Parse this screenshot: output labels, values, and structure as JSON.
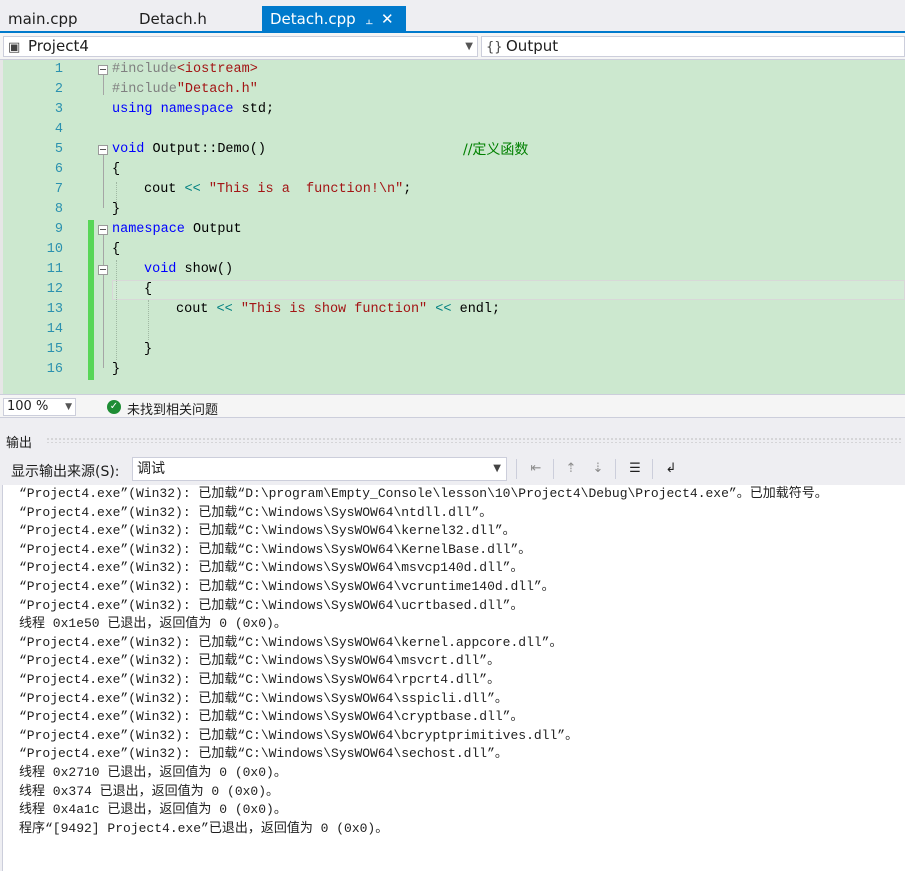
{
  "tabs": [
    {
      "label": "main.cpp",
      "active": false
    },
    {
      "label": "Detach.h",
      "active": false
    },
    {
      "label": "Detach.cpp",
      "active": true
    }
  ],
  "tab_icons": {
    "pin": "pin-icon",
    "close": "close-icon"
  },
  "navbar": {
    "project": "Project4",
    "scope": "Output"
  },
  "editor": {
    "line_numbers": [
      "1",
      "2",
      "3",
      "4",
      "5",
      "6",
      "7",
      "8",
      "9",
      "10",
      "11",
      "12",
      "13",
      "14",
      "15",
      "16"
    ]
  },
  "status": {
    "zoom": "100 %",
    "issues": "未找到相关问题"
  },
  "output": {
    "title": "输出",
    "source_label": "显示输出来源(S):",
    "source_value": "调试",
    "lines": [
      "“Project4.exe”(Win32): 已加载“D:\\program\\Empty_Console\\lesson\\10\\Project4\\Debug\\Project4.exe”。已加载符号。",
      "“Project4.exe”(Win32): 已加载“C:\\Windows\\SysWOW64\\ntdll.dll”。",
      "“Project4.exe”(Win32): 已加载“C:\\Windows\\SysWOW64\\kernel32.dll”。",
      "“Project4.exe”(Win32): 已加载“C:\\Windows\\SysWOW64\\KernelBase.dll”。",
      "“Project4.exe”(Win32): 已加载“C:\\Windows\\SysWOW64\\msvcp140d.dll”。",
      "“Project4.exe”(Win32): 已加载“C:\\Windows\\SysWOW64\\vcruntime140d.dll”。",
      "“Project4.exe”(Win32): 已加载“C:\\Windows\\SysWOW64\\ucrtbased.dll”。",
      "线程 0x1e50 已退出，返回值为 0 (0x0)。",
      "“Project4.exe”(Win32): 已加载“C:\\Windows\\SysWOW64\\kernel.appcore.dll”。",
      "“Project4.exe”(Win32): 已加载“C:\\Windows\\SysWOW64\\msvcrt.dll”。",
      "“Project4.exe”(Win32): 已加载“C:\\Windows\\SysWOW64\\rpcrt4.dll”。",
      "“Project4.exe”(Win32): 已加载“C:\\Windows\\SysWOW64\\sspicli.dll”。",
      "“Project4.exe”(Win32): 已加载“C:\\Windows\\SysWOW64\\cryptbase.dll”。",
      "“Project4.exe”(Win32): 已加载“C:\\Windows\\SysWOW64\\bcryptprimitives.dll”。",
      "“Project4.exe”(Win32): 已加载“C:\\Windows\\SysWOW64\\sechost.dll”。",
      "线程 0x2710 已退出，返回值为 0 (0x0)。",
      "线程 0x374 已退出，返回值为 0 (0x0)。",
      "线程 0x4a1c 已退出，返回值为 0 (0x0)。",
      "程序“[9492] Project4.exe”已退出，返回值为 0 (0x0)。"
    ]
  },
  "code": {
    "l1": {
      "pp": "#include",
      "str": "<iostream>"
    },
    "l2": {
      "pp": "#include",
      "str": "\"Detach.h\""
    },
    "l3": {
      "kw1": "using",
      "kw2": "namespace",
      "rest": "std;"
    },
    "l5": {
      "kw": "void",
      "rest": "Output::Demo()",
      "comment": "//定义函数"
    },
    "l6": {
      "text": "{"
    },
    "l7": {
      "a": "cout",
      "op": "<<",
      "str": "\"This is a  function!\\n\"",
      "end": ";"
    },
    "l8": {
      "text": "}"
    },
    "l9": {
      "kw": "namespace",
      "rest": "Output"
    },
    "l10": {
      "text": "{"
    },
    "l11": {
      "kw": "void",
      "rest": "show()"
    },
    "l12": {
      "text": "{"
    },
    "l13": {
      "a": "cout",
      "op": "<<",
      "str": "\"This is show function\"",
      "op2": "<<",
      "end": "endl;"
    },
    "l15": {
      "text": "}"
    },
    "l16": {
      "text": "}"
    }
  },
  "colors": {
    "accent": "#007acc",
    "editor_bg": "#cce8cf",
    "change_bar": "#57d657"
  }
}
